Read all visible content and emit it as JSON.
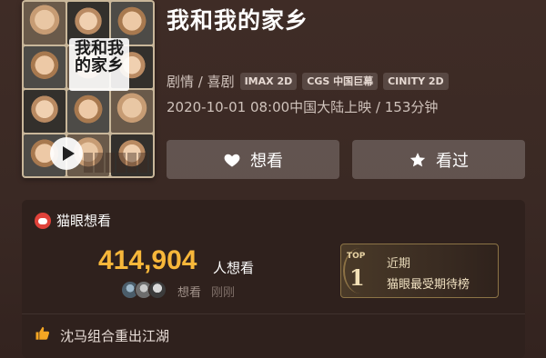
{
  "movie": {
    "title": "我和我的家乡",
    "poster_title": "我和我的家乡",
    "genres": "剧情 / 喜剧",
    "formats": [
      "IMAX 2D",
      "CGS 中国巨幕",
      "CINITY 2D"
    ],
    "release": "2020-10-01 08:00中国大陆上映 / 153分钟"
  },
  "actions": {
    "want_label": "想看",
    "seen_label": "看过"
  },
  "maoyan": {
    "header": "猫眼想看",
    "count": "414,904",
    "count_suffix": "人想看",
    "avatar_label": "想看",
    "avatar_time": "刚刚"
  },
  "rank": {
    "badge": "TOP",
    "number": "1",
    "period": "近期",
    "name": "猫眼最受期待榜"
  },
  "highlight": {
    "text": "沈马组合重出江湖"
  },
  "colors": {
    "count": "#f7b73a",
    "background": "#3b2a25",
    "card": "#2f211d"
  }
}
